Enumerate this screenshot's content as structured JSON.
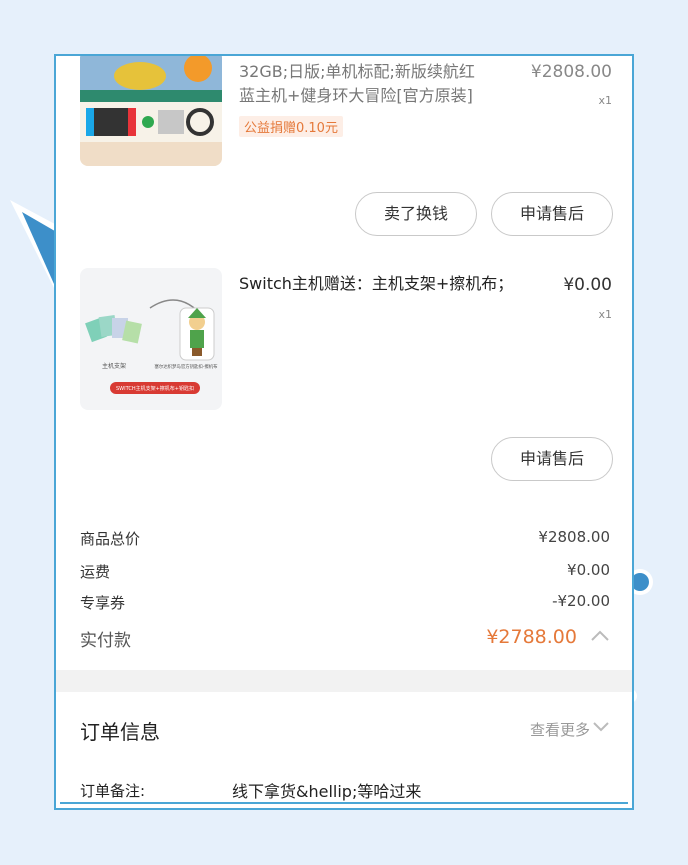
{
  "product1": {
    "title_lines": [
      "32GB;日版;单机标配;新版续航红",
      "蓝主机+健身环大冒险[官方原装]"
    ],
    "price": "¥2808.00",
    "quantity": "x1",
    "charity_tag": "公益捐赠0.10元",
    "buttons": {
      "sell": "卖了换钱",
      "after_sale": "申请售后"
    }
  },
  "product2": {
    "title": "Switch主机赠送：主机支架+擦机布；",
    "price": "¥0.00",
    "quantity": "x1",
    "image_labels": [
      "主机支架",
      "塞尔达织梦岛官方钥匙扣-擦机布",
      "SWITCH主机支架+擦机布+钥匙扣"
    ],
    "buttons": {
      "after_sale": "申请售后"
    }
  },
  "summary": {
    "rows": [
      {
        "label": "商品总价",
        "value": "¥2808.00"
      },
      {
        "label": "运费",
        "value": "¥0.00"
      },
      {
        "label": "专享券",
        "value": "-¥20.00"
      }
    ],
    "total_label": "实付款",
    "total_value": "¥2788.00"
  },
  "order_info": {
    "title": "订单信息",
    "more": "查看更多",
    "note_label": "订单备注:",
    "note_value": "线下拿货&hellip;等哈过来"
  },
  "colors": {
    "accent": "#e5793a",
    "frame": "#4aa6d6",
    "background": "#e6f0fb"
  }
}
